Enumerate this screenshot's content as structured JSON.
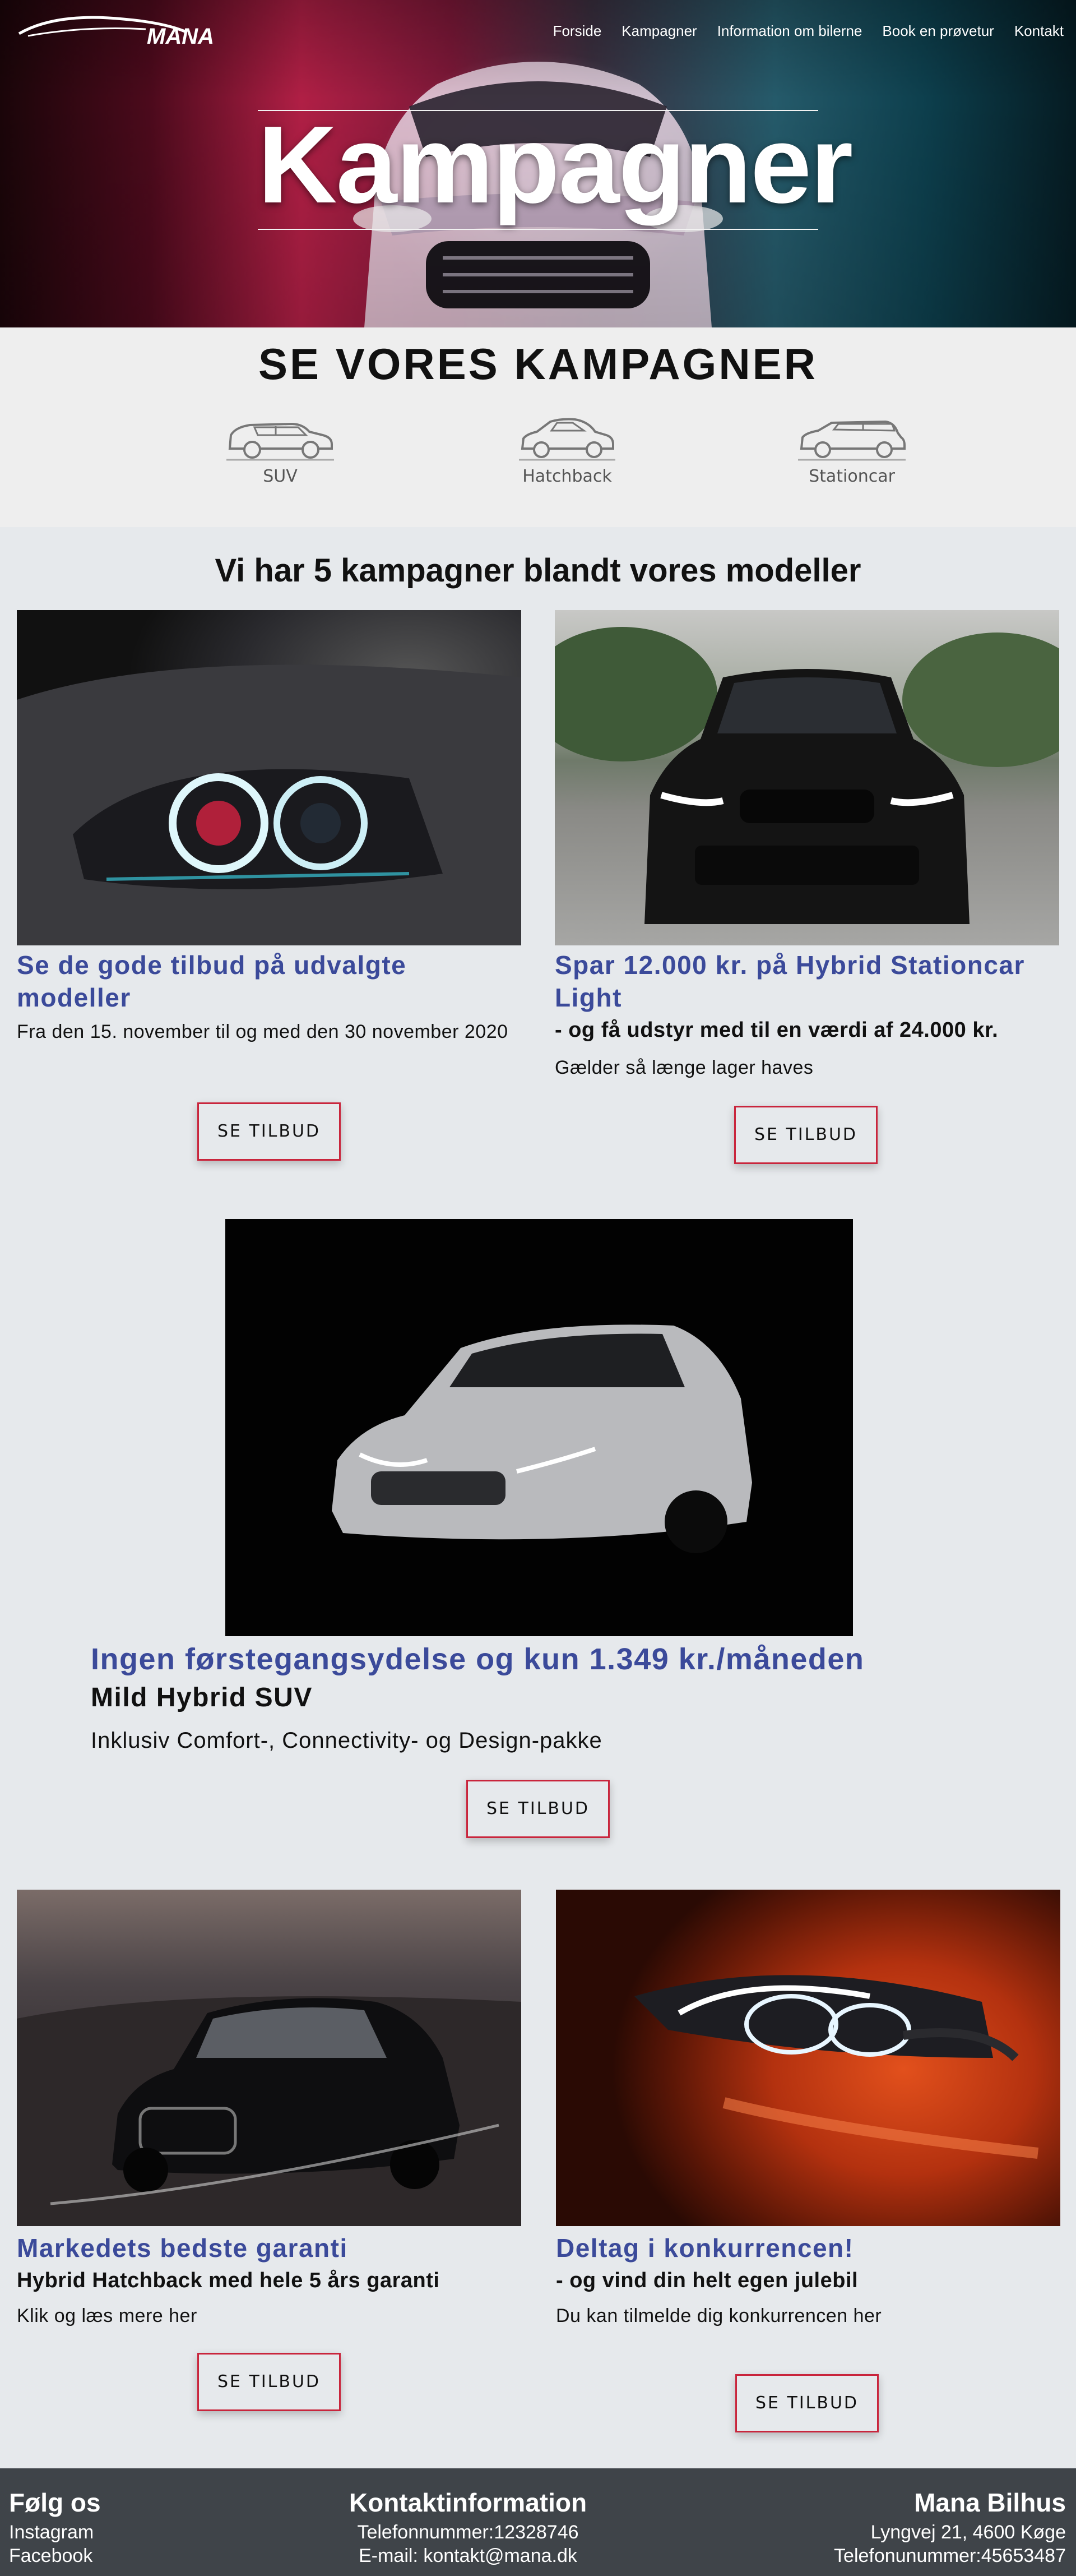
{
  "header": {
    "logo_text": "MANA",
    "nav": [
      "Forside",
      "Kampagner",
      "Information om bilerne",
      "Book en prøvetur",
      "Kontakt"
    ],
    "hero_title": "Kampagner"
  },
  "categories": {
    "heading": "SE VORES KAMPAGNER",
    "items": [
      {
        "label": "SUV",
        "icon": "suv-icon"
      },
      {
        "label": "Hatchback",
        "icon": "hatchback-icon"
      },
      {
        "label": "Stationcar",
        "icon": "stationcar-icon"
      }
    ]
  },
  "campaigns": {
    "heading": "Vi har 5 kampagner blandt vores modeller",
    "button_label": "SE TILBUD",
    "cards": [
      {
        "title": "Se de gode tilbud på udvalgte modeller",
        "subtitle": "",
        "text": "Fra den 15. november til og med den 30 november 2020"
      },
      {
        "title": "Spar 12.000 kr. på Hybrid Stationcar Light",
        "subtitle": "- og få udstyr med til en værdi af 24.000 kr.",
        "text": "Gælder så længe lager haves"
      },
      {
        "title": "Ingen førstegangsydelse og kun 1.349 kr./måneden",
        "subtitle": "Mild Hybrid SUV",
        "text": "Inklusiv Comfort-, Connectivity- og Design-pakke"
      },
      {
        "title": "Markedets bedste garanti",
        "subtitle": "Hybrid Hatchback med hele 5 års garanti",
        "text": "Klik og læs mere her"
      },
      {
        "title": "Deltag i konkurrencen!",
        "subtitle": "- og vind din helt egen julebil",
        "text": "Du kan tilmelde dig konkurrencen her"
      }
    ]
  },
  "footer": {
    "follow": {
      "title": "Følg os",
      "links": [
        "Instagram",
        "Facebook"
      ]
    },
    "contact": {
      "title": "Kontaktinformation",
      "phone": "Telefonnummer:12328746",
      "email": "E-mail: kontakt@mana.dk"
    },
    "company": {
      "title": "Mana Bilhus",
      "address": "Lyngvej 21, 4600 Køge",
      "phone": "Telefonunummer:45653487"
    }
  },
  "colors": {
    "accent_title": "#3b4a9a",
    "button_border": "#c9253c",
    "page_bg": "#e6e9ec",
    "footer_bg": "#3f4449"
  }
}
